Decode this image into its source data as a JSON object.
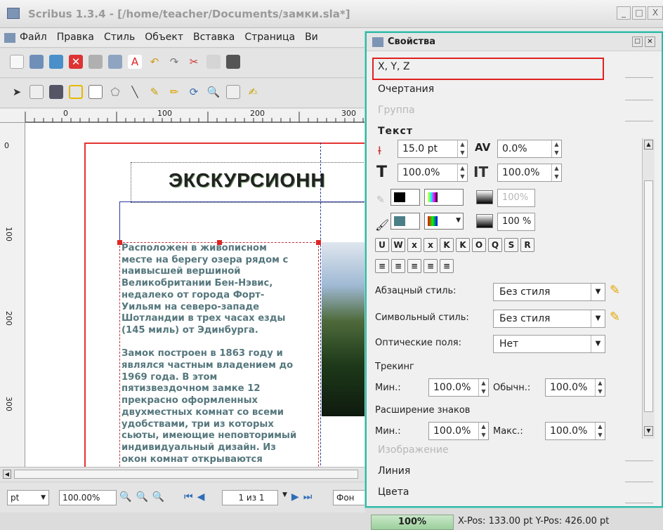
{
  "window": {
    "title": "Scribus 1.3.4 - [/home/teacher/Documents/замки.sla*]",
    "controls": {
      "minimize": "_",
      "maximize": "□",
      "close": "X"
    }
  },
  "menubar": {
    "items": [
      "Файл",
      "Правка",
      "Стиль",
      "Объект",
      "Вставка",
      "Страница",
      "Ви"
    ]
  },
  "rulers": {
    "horizontal_ticks": [
      "0",
      "100",
      "200",
      "300"
    ],
    "vertical_ticks": [
      "0",
      "100",
      "200",
      "300"
    ]
  },
  "document": {
    "title_text": "ЭКСКУРСИОНН",
    "body_text": "Расположен в живописном\nместе на берегу озера рядом с\nнаивысшей вершиной\nВеликобритании Бен-Нэвис,\nнедалеко от города Форт-\nУильям на северо-западе\nШотландии в трех часах езды\n(145 миль) от Эдинбурга.\n\nЗамок построен в 1863 году и\nявлялся частным владением до\n1969 года. В этом\nпятизвездочном замке 12\nпрекрасно оформленных\nдвухместных комнат со всеми\nудобствами, три из которых\nсьюты, имеющие неповторимый\nиндивидуальный дизайн. Из\nокон комнат открываются\nвеликолепные виды на"
  },
  "bottombar": {
    "unit": "pt",
    "zoom": "100.00%",
    "page": "1 из 1",
    "layer": "Фон"
  },
  "status": {
    "zoom_badge": "100%",
    "coords": "X-Pos: 133.00 pt   Y-Pos: 426.00 pt"
  },
  "properties": {
    "title": "Свойства",
    "sections": {
      "xyz": "X, Y, Z",
      "shape": "Очертания",
      "group": "Группа",
      "text": "Текст",
      "image": "Изображение",
      "line": "Линия",
      "colors": "Цвета"
    },
    "text": {
      "font_size": "15.0 pt",
      "kerning": "0.0%",
      "scale_width": "100.0%",
      "scale_height": "100.0%",
      "stroke_shade": "100%",
      "fill_shade": "100 %",
      "para_style_label": "Абзацный стиль:",
      "para_style_value": "Без стиля",
      "char_style_label": "Символьный стиль:",
      "char_style_value": "Без стиля",
      "optical_label": "Оптические поля:",
      "optical_value": "Нет",
      "tracking_label": "Трекинг",
      "min_label": "Мин.:",
      "tracking_min": "100.0%",
      "normal_label": "Обычн.:",
      "tracking_normal": "100.0%",
      "glyph_label": "Расширение знаков",
      "glyph_min_label": "Мин.:",
      "glyph_min": "100.0%",
      "glyph_max_label": "Макс.:",
      "glyph_max": "100.0%"
    },
    "format_buttons": [
      "U",
      "W",
      "x",
      "x",
      "K",
      "K",
      "O",
      "Q",
      "S",
      "R"
    ],
    "highlight_color": "#e02020"
  }
}
